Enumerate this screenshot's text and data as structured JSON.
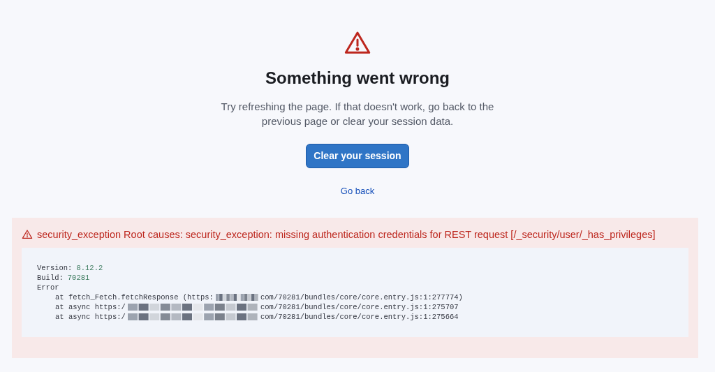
{
  "title": "Something went wrong",
  "message": "Try refreshing the page. If that doesn't work, go back to the previous page or clear your session data.",
  "primary_button": "Clear your session",
  "link": "Go back",
  "error": {
    "title": "security_exception Root causes: security_exception: missing authentication credentials for REST request [/_security/user/_has_privileges]",
    "fields": [
      {
        "label": "Version:",
        "value": "8.12.2"
      },
      {
        "label": "Build:",
        "value": "70281"
      }
    ],
    "heading": "Error",
    "stack": [
      {
        "prefix": "at fetch_Fetch.fetchResponse (https:",
        "redacted": true,
        "suffix": "com/70281/bundles/core/core.entry.js:1:277774)"
      },
      {
        "prefix": "at async https:/",
        "redacted": true,
        "suffix": "com/70281/bundles/core/core.entry.js:1:275707"
      },
      {
        "prefix": "at async https:/",
        "redacted": true,
        "suffix": "com/70281/bundles/core/core.entry.js:1:275664"
      }
    ]
  }
}
